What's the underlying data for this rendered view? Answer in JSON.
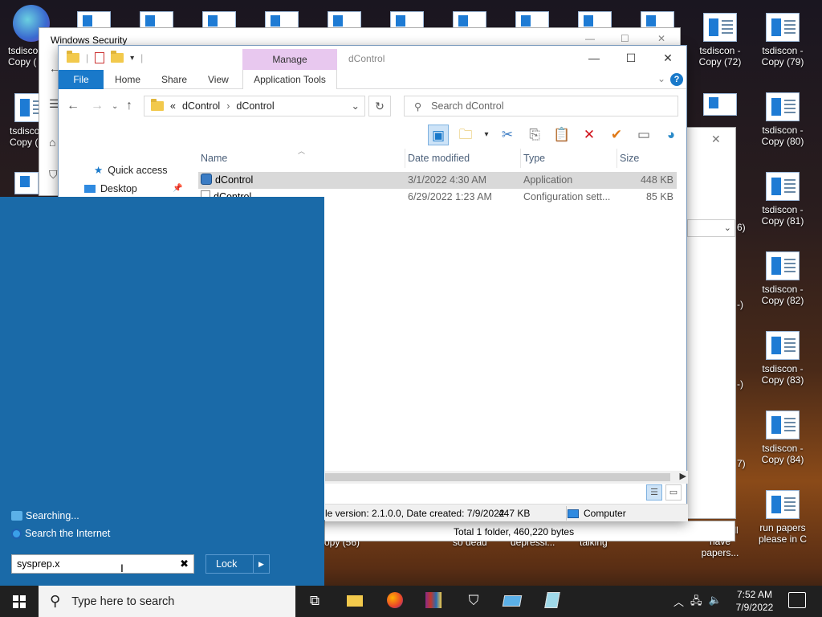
{
  "desktop": {
    "icons_right": [
      {
        "l1": "tsdiscon -",
        "l2": "Copy (72)"
      },
      {
        "l1": "tsdiscon -",
        "l2": "Copy (79)"
      },
      {
        "l1": "tsdiscon -",
        "l2": "Copy (80)"
      },
      {
        "l1": "tsdiscon -",
        "l2": "Copy (81)"
      },
      {
        "l1": "tsdiscon -",
        "l2": "Copy (82)"
      },
      {
        "l1": "tsdiscon -",
        "l2": "Copy (83)"
      },
      {
        "l1": "tsdiscon -",
        "l2": "Copy (84)"
      },
      {
        "l1": "run papers",
        "l2": "please in C"
      }
    ],
    "icons_left": [
      {
        "l1": "tsdisco",
        "l2": "Copy ("
      },
      {
        "l1": "tsdisco",
        "l2": "Copy ("
      }
    ],
    "partial_labels": [
      {
        "l1": "opy (56)"
      },
      {
        "l1": "so dead"
      },
      {
        "l1": "depressi..."
      },
      {
        "l1": "talking"
      },
      {
        "l1": "still",
        "l2": "have papers..."
      }
    ],
    "edge_fragments": [
      "6)",
      "-)",
      "-)",
      "7)"
    ]
  },
  "windows_security": {
    "title": "Windows Security"
  },
  "explorer": {
    "title": "dControl",
    "manage_tab": "Manage",
    "ribbon_tabs": [
      "File",
      "Home",
      "Share",
      "View",
      "Application Tools"
    ],
    "address": {
      "prefix": "«",
      "crumbs": [
        "dControl",
        "dControl"
      ]
    },
    "search_placeholder": "Search dControl",
    "columns": [
      "Name",
      "Date modified",
      "Type",
      "Size"
    ],
    "files": [
      {
        "name": "dControl",
        "date": "3/1/2022 4:30 AM",
        "type": "Application",
        "size": "448 KB"
      },
      {
        "name": "dControl",
        "date": "6/29/2022 1:23 AM",
        "type": "Configuration sett...",
        "size": "85 KB"
      }
    ],
    "nav": {
      "quick_access": "Quick access",
      "desktop": "Desktop"
    },
    "status": {
      "details": "le version: 2.1.0.0, Date created: 7/9/2022",
      "size": "447 KB",
      "location": "Computer"
    }
  },
  "bg_window_status": "Total 1 folder, 460,220 bytes",
  "start_panel": {
    "searching": "Searching...",
    "search_internet": "Search the Internet",
    "run_value": "sysprep.x",
    "lock_label": "Lock"
  },
  "taskbar": {
    "search_placeholder": "Type here to search",
    "time": "7:52 AM",
    "date": "7/9/2022"
  },
  "colors": {
    "accent": "#1979ca",
    "panel": "#1a6aa8",
    "manage_tab": "#e8c8ef"
  }
}
